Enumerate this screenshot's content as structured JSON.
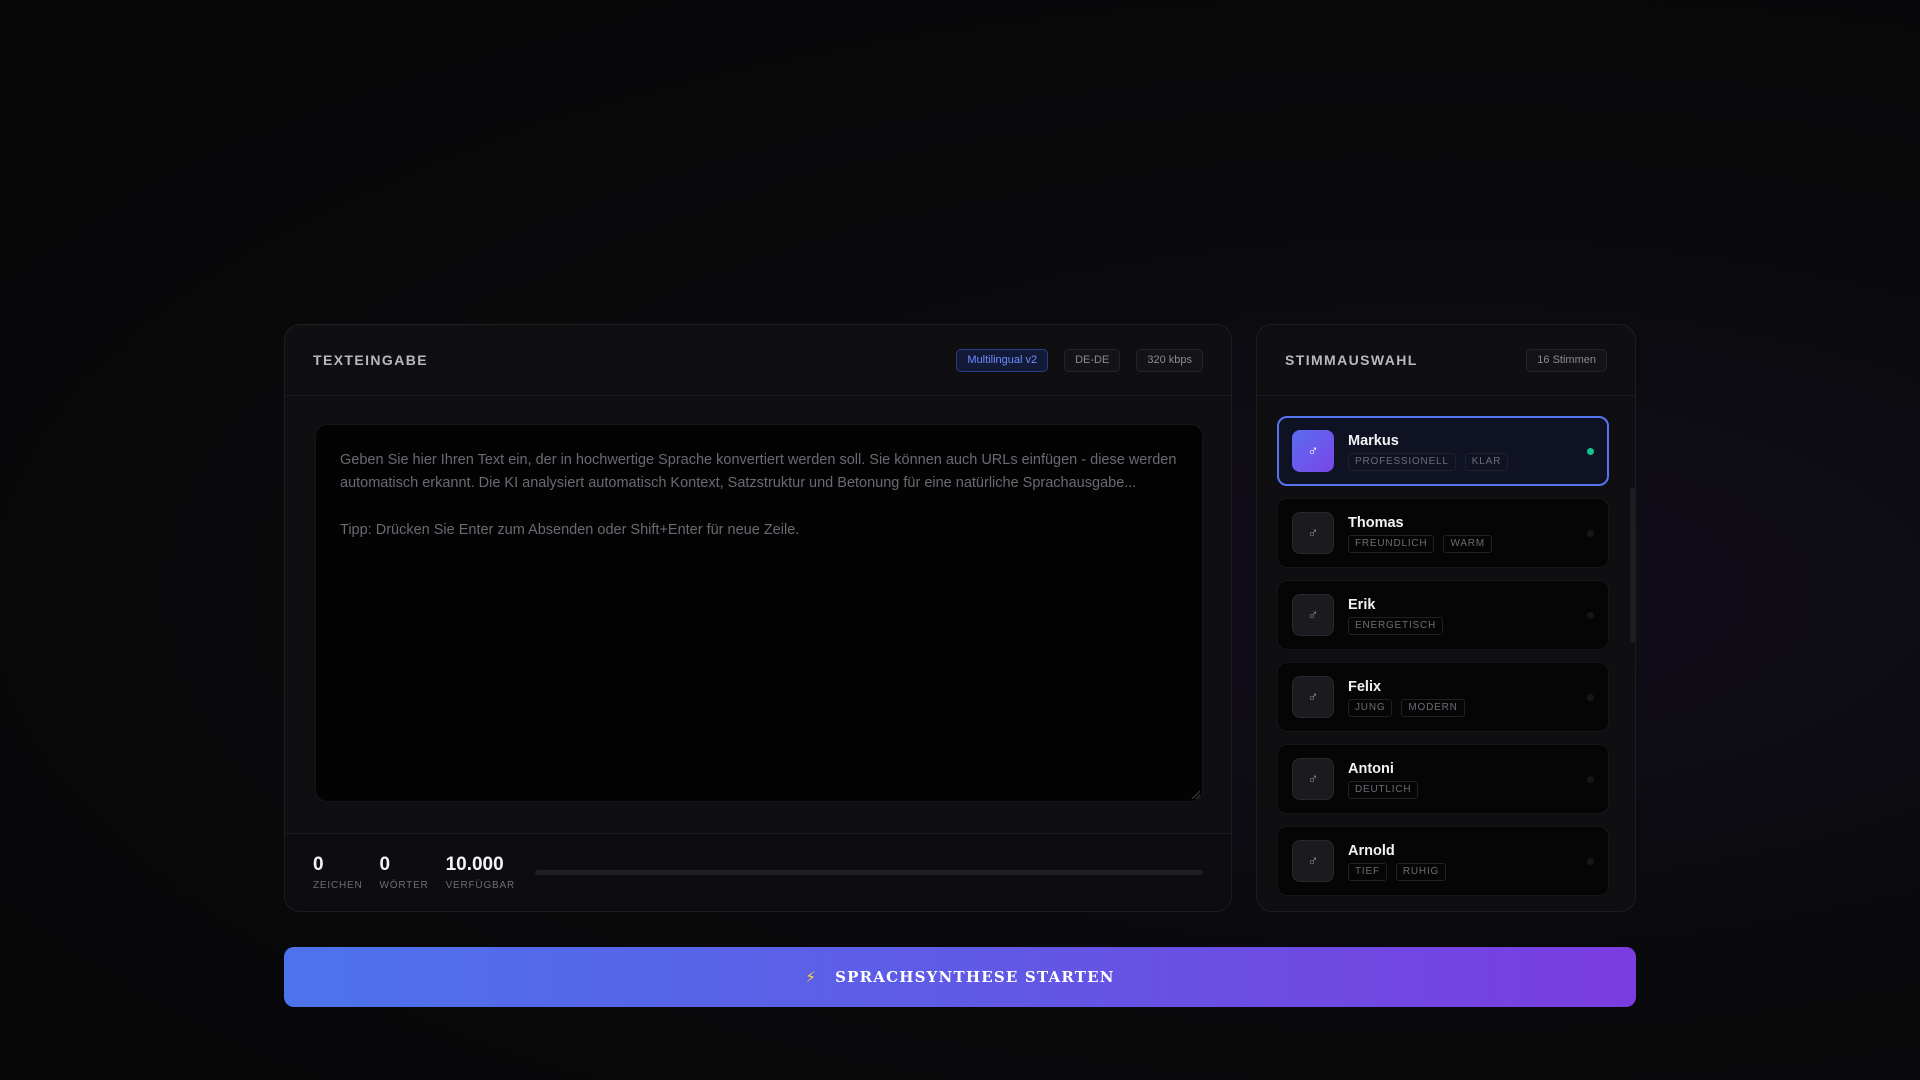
{
  "text_panel": {
    "title": "TEXTEINGABE",
    "badges": [
      "Multilingual v2",
      "DE-DE",
      "320 kbps"
    ],
    "placeholder_line1": "Geben Sie hier Ihren Text ein, der in hochwertige Sprache konvertiert werden soll. Sie können auch URLs einfügen - diese werden automatisch erkannt. Die KI analysiert automatisch Kontext, Satzstruktur und Betonung für eine natürliche Sprachausgabe...",
    "placeholder_line2": "Tipp: Drücken Sie Enter zum Absenden oder Shift+Enter für neue Zeile.",
    "stats": [
      {
        "value": "0",
        "label": "ZEICHEN"
      },
      {
        "value": "0",
        "label": "WÖRTER"
      },
      {
        "value": "10.000",
        "label": "VERFÜGBAR"
      }
    ],
    "usage_fraction": 0
  },
  "voice_panel": {
    "title": "STIMMAUSWAHL",
    "count_badge": "16 Stimmen",
    "avatar_icon": "male-icon",
    "avatar_glyph": "♂",
    "selected_index": 0,
    "voices": [
      {
        "name": "Markus",
        "tags": [
          "PROFESSIONELL",
          "KLAR"
        ]
      },
      {
        "name": "Thomas",
        "tags": [
          "FREUNDLICH",
          "WARM"
        ]
      },
      {
        "name": "Erik",
        "tags": [
          "ENERGETISCH"
        ]
      },
      {
        "name": "Felix",
        "tags": [
          "JUNG",
          "MODERN"
        ]
      },
      {
        "name": "Antoni",
        "tags": [
          "DEUTLICH"
        ]
      },
      {
        "name": "Arnold",
        "tags": [
          "TIEF",
          "RUHIG"
        ]
      }
    ]
  },
  "cta": {
    "icon": "lightning-icon",
    "icon_glyph": "⚡",
    "label": "SPRACHSYNTHESE STARTEN"
  },
  "colors": {
    "accent_blue": "#5474f0",
    "accent_purple": "#7b3ce0",
    "active_dot": "#10c48a"
  }
}
